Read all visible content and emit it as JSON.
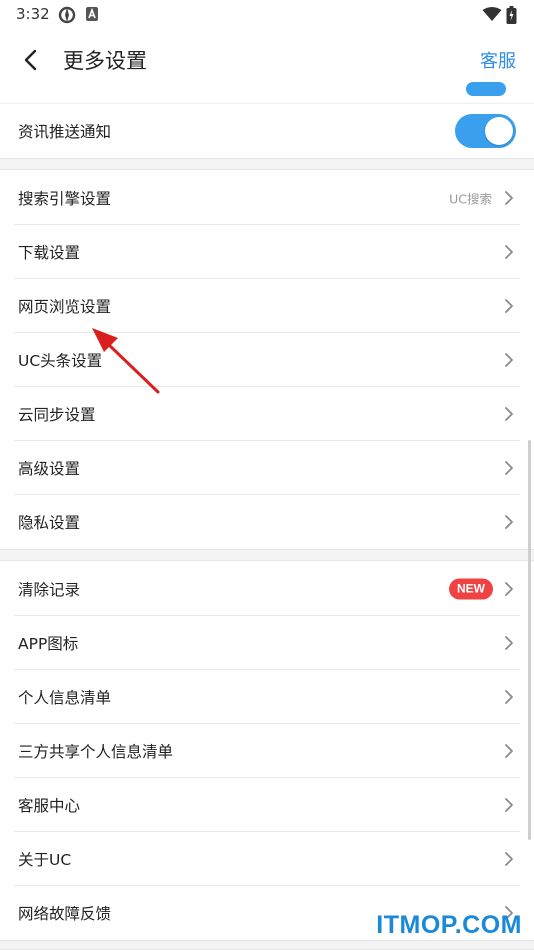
{
  "status_bar": {
    "time": "3:32"
  },
  "header": {
    "title": "更多设置",
    "action": "客服"
  },
  "push_row": {
    "label": "资讯推送通知",
    "enabled": true
  },
  "group1": [
    {
      "label": "搜索引擎设置",
      "value": "UC搜索"
    },
    {
      "label": "下载设置"
    },
    {
      "label": "网页浏览设置"
    },
    {
      "label": "UC头条设置"
    },
    {
      "label": "云同步设置"
    },
    {
      "label": "高级设置"
    },
    {
      "label": "隐私设置"
    }
  ],
  "group2": [
    {
      "label": "清除记录",
      "badge": "NEW"
    },
    {
      "label": "APP图标"
    },
    {
      "label": "个人信息清单"
    },
    {
      "label": "三方共享个人信息清单"
    },
    {
      "label": "客服中心"
    },
    {
      "label": "关于UC"
    },
    {
      "label": "网络故障反馈"
    }
  ],
  "watermark": "ITMOP.COM",
  "colors": {
    "accent": "#2f8fe8",
    "toggle_on": "#3aa0ee",
    "badge": "#ef4343",
    "annotation": "#d9201f",
    "watermark": "#1a8ad8"
  },
  "icons": [
    "signal-app-icon",
    "notification-app-icon",
    "wifi-icon",
    "battery-icon",
    "back-arrow-icon",
    "chevron-right-icon",
    "annotation-arrow-icon"
  ]
}
